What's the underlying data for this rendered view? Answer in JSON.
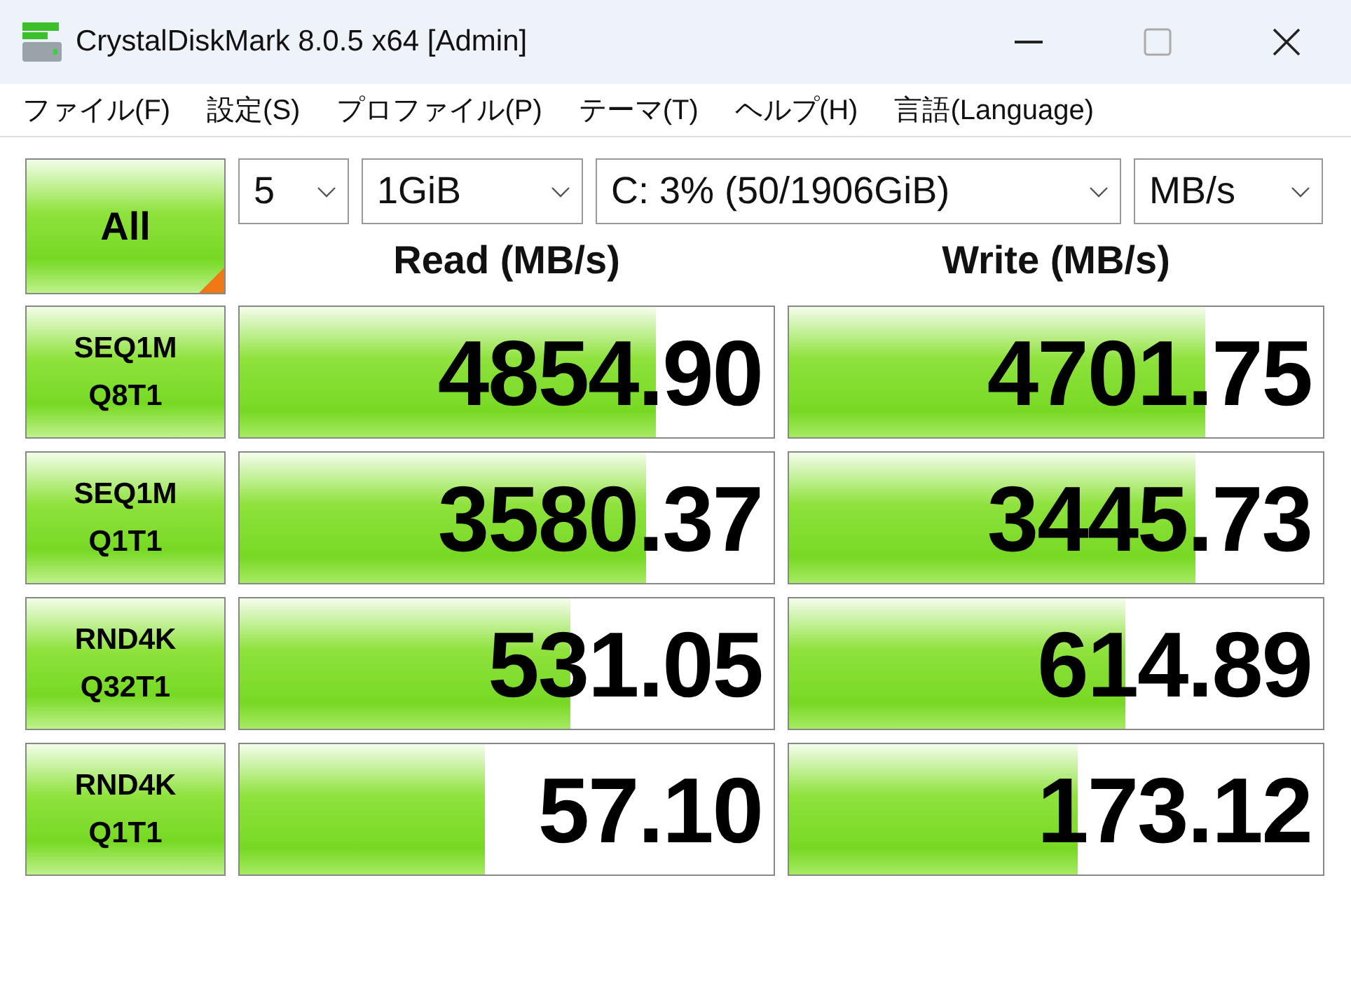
{
  "window": {
    "title": "CrystalDiskMark 8.0.5 x64 [Admin]"
  },
  "menu": [
    "ファイル(F)",
    "設定(S)",
    "プロファイル(P)",
    "テーマ(T)",
    "ヘルプ(H)",
    "言語(Language)"
  ],
  "all_button": {
    "label": "All"
  },
  "selectors": [
    {
      "value": "5"
    },
    {
      "value": "1GiB"
    },
    {
      "value": "C: 3% (50/1906GiB)"
    },
    {
      "value": "MB/s"
    }
  ],
  "headers": {
    "read": "Read (MB/s)",
    "write": "Write (MB/s)"
  },
  "tests": [
    {
      "line1": "SEQ1M",
      "line2": "Q8T1",
      "read": {
        "value": "4854.90",
        "level": 0.78
      },
      "write": {
        "value": "4701.75",
        "level": 0.78
      }
    },
    {
      "line1": "SEQ1M",
      "line2": "Q1T1",
      "read": {
        "value": "3580.37",
        "level": 0.76
      },
      "write": {
        "value": "3445.73",
        "level": 0.76
      }
    },
    {
      "line1": "RND4K",
      "line2": "Q32T1",
      "read": {
        "value": "531.05",
        "level": 0.62
      },
      "write": {
        "value": "614.89",
        "level": 0.63
      }
    },
    {
      "line1": "RND4K",
      "line2": "Q1T1",
      "read": {
        "value": "57.10",
        "level": 0.46
      },
      "write": {
        "value": "173.12",
        "level": 0.54
      }
    }
  ]
}
